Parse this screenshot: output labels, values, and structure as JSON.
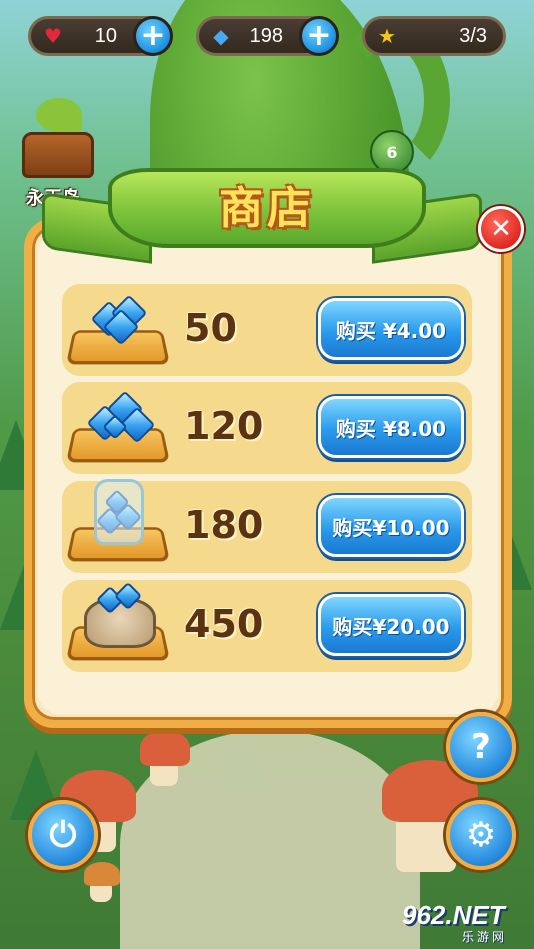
{
  "hud": {
    "lives": {
      "icon": "broken-heart-icon",
      "value": "10"
    },
    "gems": {
      "icon": "gem-icon",
      "value": "198"
    },
    "stars": {
      "icon": "star-icon",
      "value": "3/3"
    }
  },
  "side_badge": {
    "label": "永玉岛",
    "icon": "treasure-chest-icon"
  },
  "level_badge": {
    "value": "6"
  },
  "shop": {
    "title": "商店",
    "close_icon": "close-icon",
    "items": [
      {
        "amount": "50",
        "price_label": "购买 ¥4.00",
        "icon": "gem-pile-small-icon"
      },
      {
        "amount": "120",
        "price_label": "购买 ¥8.00",
        "icon": "gem-pile-medium-icon"
      },
      {
        "amount": "180",
        "price_label": "购买¥10.00",
        "icon": "gem-jar-icon"
      },
      {
        "amount": "450",
        "price_label": "购买¥20.00",
        "icon": "gem-sack-icon"
      }
    ]
  },
  "controls": {
    "power_icon": "power-icon",
    "settings_icon": "gear-icon",
    "help_icon": "question-icon",
    "help_label": "?"
  },
  "watermark": {
    "main": "962.NET",
    "sub": "乐游网"
  },
  "colors": {
    "panel_border": "#f0ae47",
    "ribbon_green": "#7cc33a",
    "buy_button_blue": "#2a9bec",
    "title_yellow": "#ffe35a",
    "close_red": "#e02a22"
  }
}
